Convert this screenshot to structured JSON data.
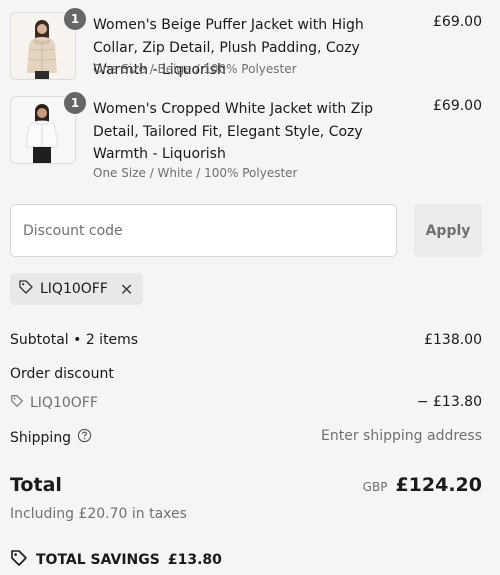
{
  "cart": {
    "items": [
      {
        "quantity": "1",
        "title": "Women's Beige Puffer Jacket with High Collar, Zip Detail, Plush Padding, Cozy Warmth - Liquorish",
        "variant": "One Size / Beige / 100% Polyester",
        "price": "£69.00"
      },
      {
        "quantity": "1",
        "title": "Women's Cropped White Jacket with Zip Detail, Tailored Fit, Elegant Style, Cozy Warmth - Liquorish",
        "variant": "One Size / White / 100% Polyester",
        "price": "£69.00"
      }
    ]
  },
  "discount": {
    "placeholder": "Discount code",
    "apply_label": "Apply",
    "applied_code": "LIQ10OFF",
    "remove_symbol": "✕"
  },
  "summary": {
    "subtotal_label": "Subtotal • 2 items",
    "subtotal_value": "£138.00",
    "order_discount_label": "Order discount",
    "discount_code": "LIQ10OFF",
    "discount_value": "− £13.80",
    "shipping_label": "Shipping",
    "shipping_value": "Enter shipping address",
    "total_label": "Total",
    "currency": "GBP",
    "total_value": "£124.20",
    "tax_note": "Including £20.70 in taxes",
    "savings_label": "TOTAL SAVINGS",
    "savings_value": "£13.80"
  },
  "colors": {
    "background": "#f5f5f5",
    "muted_text": "#707070",
    "badge": "#666666",
    "chip": "#e8e8e8"
  },
  "icons": [
    "tag-icon",
    "help-circle-icon",
    "close-icon",
    "savings-tag-icon"
  ]
}
